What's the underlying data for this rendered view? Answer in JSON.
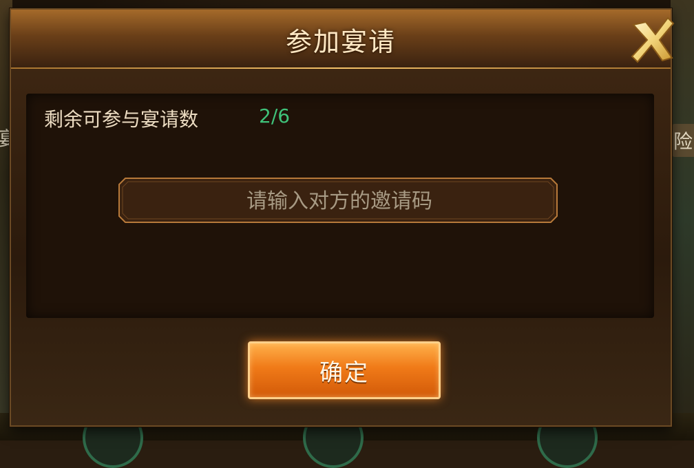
{
  "background": {
    "left_text": "宴",
    "right_text": "险"
  },
  "dialog": {
    "title": "参加宴请",
    "close_icon": "close-x-icon",
    "remaining_label": "剩余可参与宴请数",
    "remaining_value": "2/6",
    "invite_code_placeholder": "请输入对方的邀请码",
    "invite_code_value": "",
    "confirm_label": "确定"
  },
  "colors": {
    "accent_orange": "#f07a18",
    "value_green": "#3fc27a",
    "title_text": "#ffe8c4"
  }
}
